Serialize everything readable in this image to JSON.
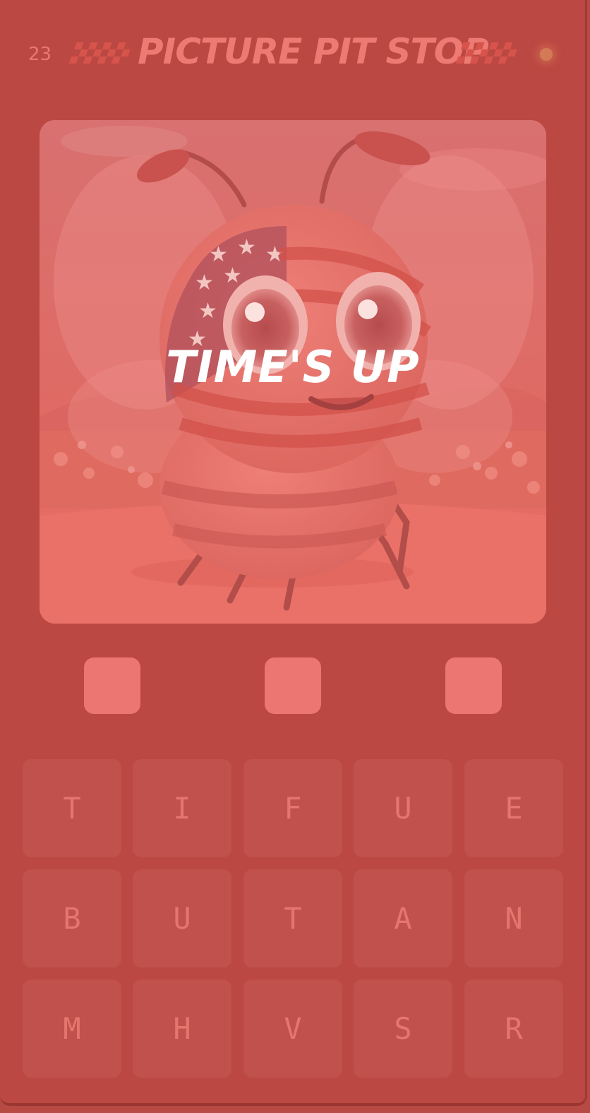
{
  "header": {
    "round": "23",
    "title": "PICTURE PIT STOP"
  },
  "puzzle": {
    "status_text": "TIME'S UP",
    "image": "cartoon-bee-with-american-flag-face"
  },
  "answer": {
    "slots": [
      "",
      "",
      ""
    ]
  },
  "keyboard": {
    "rows": [
      [
        "T",
        "I",
        "F",
        "U",
        "E"
      ],
      [
        "B",
        "U",
        "T",
        "A",
        "N"
      ],
      [
        "M",
        "H",
        "V",
        "S",
        "R"
      ]
    ]
  },
  "colors": {
    "background": "#bb4842",
    "title": "#ed7a73",
    "slot": "#ec7671",
    "key": "#c0514c",
    "key_text": "#e4756f",
    "overlay_text": "#ffffff"
  }
}
